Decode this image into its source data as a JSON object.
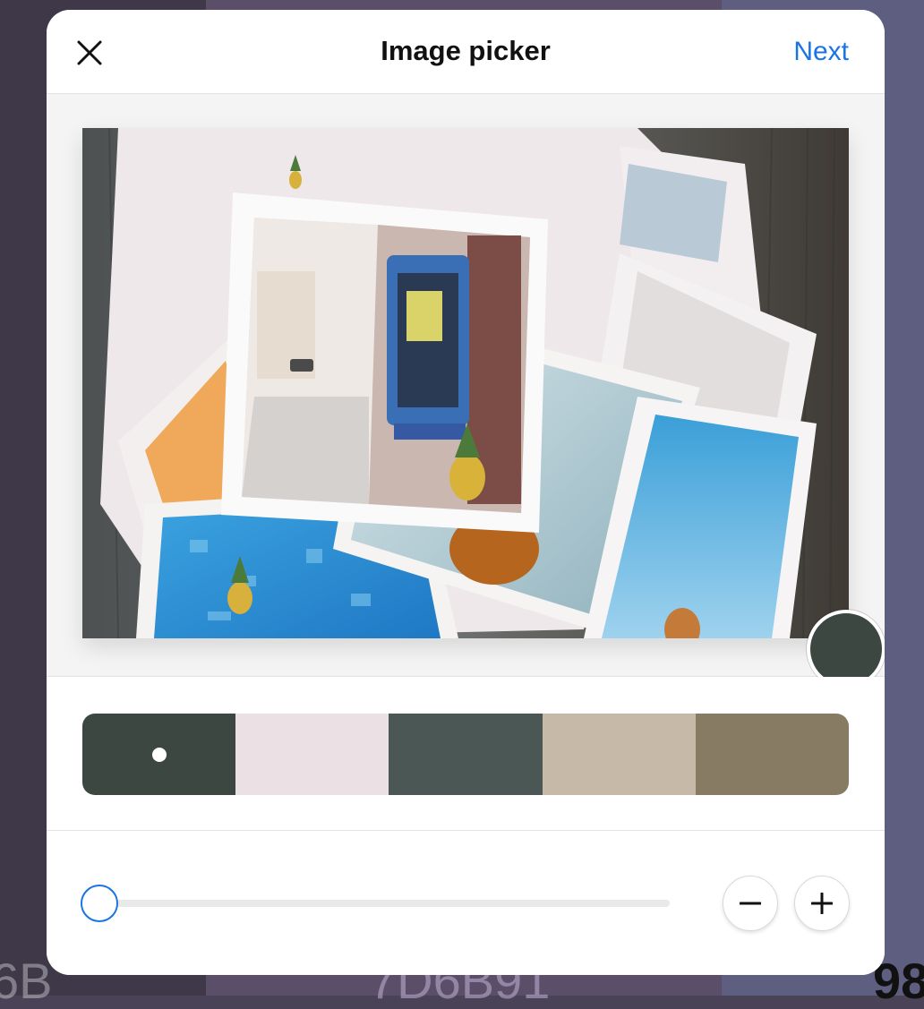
{
  "modal": {
    "title": "Image picker",
    "next_label": "Next",
    "close_icon": "close-icon"
  },
  "background": {
    "labels": [
      "6B",
      "7D6B91",
      "98"
    ],
    "colors": [
      "#3e3849",
      "#5a4e69",
      "#5e5f80"
    ]
  },
  "picker": {
    "loupe_color": "#3b4740"
  },
  "palette": {
    "swatches": [
      {
        "color": "#3b4740",
        "selected": true
      },
      {
        "color": "#ebe1e4",
        "selected": false
      },
      {
        "color": "#4a5754",
        "selected": false
      },
      {
        "color": "#c7b9a7",
        "selected": false
      },
      {
        "color": "#877b64",
        "selected": false
      }
    ]
  },
  "controls": {
    "slider_value": 0,
    "minus_icon": "minus-icon",
    "plus_icon": "plus-icon",
    "accent": "#1b74e4"
  }
}
